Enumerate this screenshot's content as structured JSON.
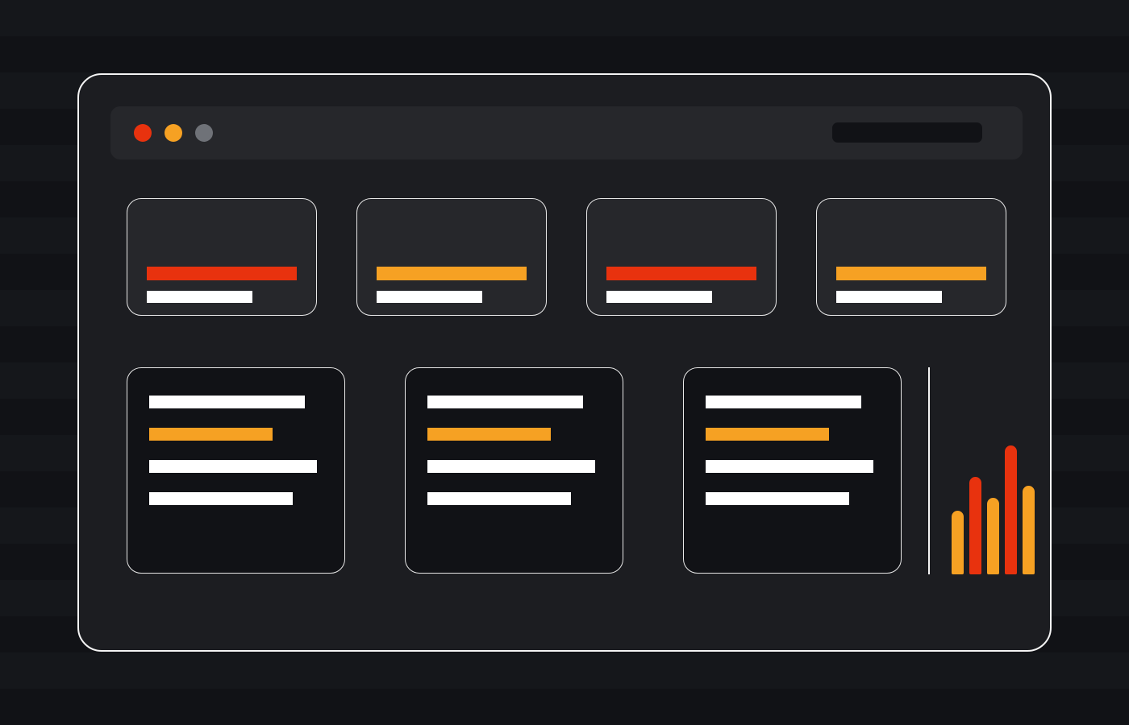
{
  "colors": {
    "red": "#e8320e",
    "orange": "#f6a123",
    "gray": "#6f7278",
    "white": "#ffffff"
  },
  "window_controls": [
    "close",
    "minimize",
    "maximize"
  ],
  "stat_cards": [
    {
      "accent": "red"
    },
    {
      "accent": "orange"
    },
    {
      "accent": "red"
    },
    {
      "accent": "orange"
    }
  ],
  "content_cards": [
    {
      "highlight": "orange"
    },
    {
      "highlight": "orange"
    },
    {
      "highlight": "orange"
    }
  ],
  "mini_chart": {
    "type": "bar",
    "values": [
      0.44,
      0.67,
      0.53,
      0.89,
      0.61
    ],
    "colors": [
      "orange",
      "red",
      "orange",
      "red",
      "orange"
    ]
  }
}
